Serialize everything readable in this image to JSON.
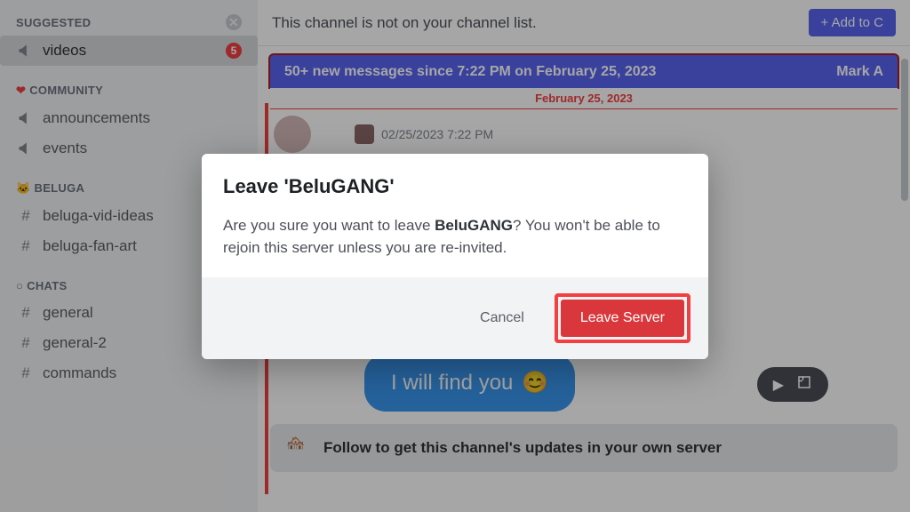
{
  "sidebar": {
    "suggested_label": "SUGGESTED",
    "suggested_item": {
      "label": "videos",
      "badge": "5"
    },
    "community_label": "COMMUNITY",
    "community_items": [
      "announcements",
      "events"
    ],
    "beluga_label": "BELUGA",
    "beluga_items": [
      "beluga-vid-ideas",
      "beluga-fan-art"
    ],
    "chats_label": "CHATS",
    "chats_items": [
      "general",
      "general-2",
      "commands"
    ]
  },
  "main": {
    "notice": "This channel is not on your channel list.",
    "add_button": "+  Add to C",
    "new_messages": "50+ new messages since 7:22 PM on February 25, 2023",
    "mark_action": "Mark A",
    "date_separator": "February 25, 2023",
    "msg_timestamp": "02/25/2023 7:22 PM",
    "bubble_text": "I will find you",
    "bubble_emoji": "😊",
    "follow_text": "Follow to get this channel's updates in your own server"
  },
  "modal": {
    "title": "Leave 'BeluGANG'",
    "text_pre": "Are you sure you want to leave ",
    "text_bold": "BeluGANG",
    "text_post": "? You won't be able to rejoin this server unless you are re-invited.",
    "cancel": "Cancel",
    "confirm": "Leave Server"
  }
}
